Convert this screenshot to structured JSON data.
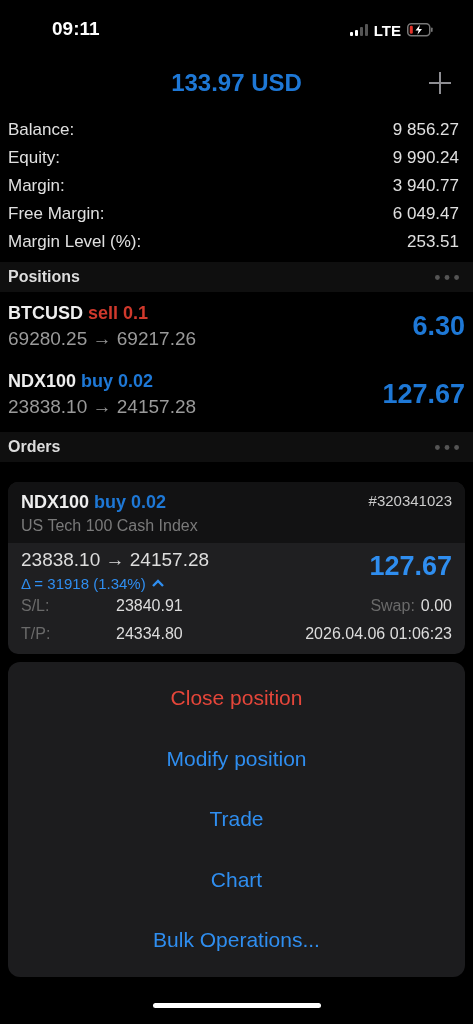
{
  "status_bar": {
    "time": "09:11",
    "network": "LTE"
  },
  "header": {
    "title": "133.97 USD"
  },
  "account": [
    {
      "label": "Balance:",
      "value": "9 856.27"
    },
    {
      "label": "Equity:",
      "value": "9 990.24"
    },
    {
      "label": "Margin:",
      "value": "3 940.77"
    },
    {
      "label": "Free Margin:",
      "value": "6 049.47"
    },
    {
      "label": "Margin Level (%):",
      "value": "253.51"
    }
  ],
  "positions": {
    "title": "Positions",
    "items": [
      {
        "symbol": "BTCUSD",
        "side": "sell 0.1",
        "kind": "sell",
        "prices": "69280.25 → 69217.26",
        "profit": "6.30"
      },
      {
        "symbol": "NDX100",
        "side": "buy 0.02",
        "kind": "buy",
        "prices": "23838.10 → 24157.28",
        "profit": "127.67"
      }
    ]
  },
  "orders": {
    "title": "Orders"
  },
  "detail": {
    "symbol": "NDX100",
    "side": "buy 0.02",
    "kind": "buy",
    "ticket": "#320341023",
    "description": "US Tech 100 Cash Index",
    "prices": "23838.10 → 24157.28",
    "delta": "Δ = 31918 (1.34%)",
    "expanded": true,
    "profit": "127.67",
    "fields": [
      {
        "label": "S/L:",
        "value": "23840.91",
        "label_2": "Swap:",
        "value_2": "0.00"
      },
      {
        "label": "T/P:",
        "value": "24334.80",
        "value_2": "2026.04.06 01:06:23"
      }
    ]
  },
  "actions": [
    {
      "label": "Close position",
      "kind": "destructive"
    },
    {
      "label": "Modify position",
      "kind": "default"
    },
    {
      "label": "Trade",
      "kind": "default"
    },
    {
      "label": "Chart",
      "kind": "default"
    },
    {
      "label": "Bulk Operations...",
      "kind": "default"
    }
  ]
}
